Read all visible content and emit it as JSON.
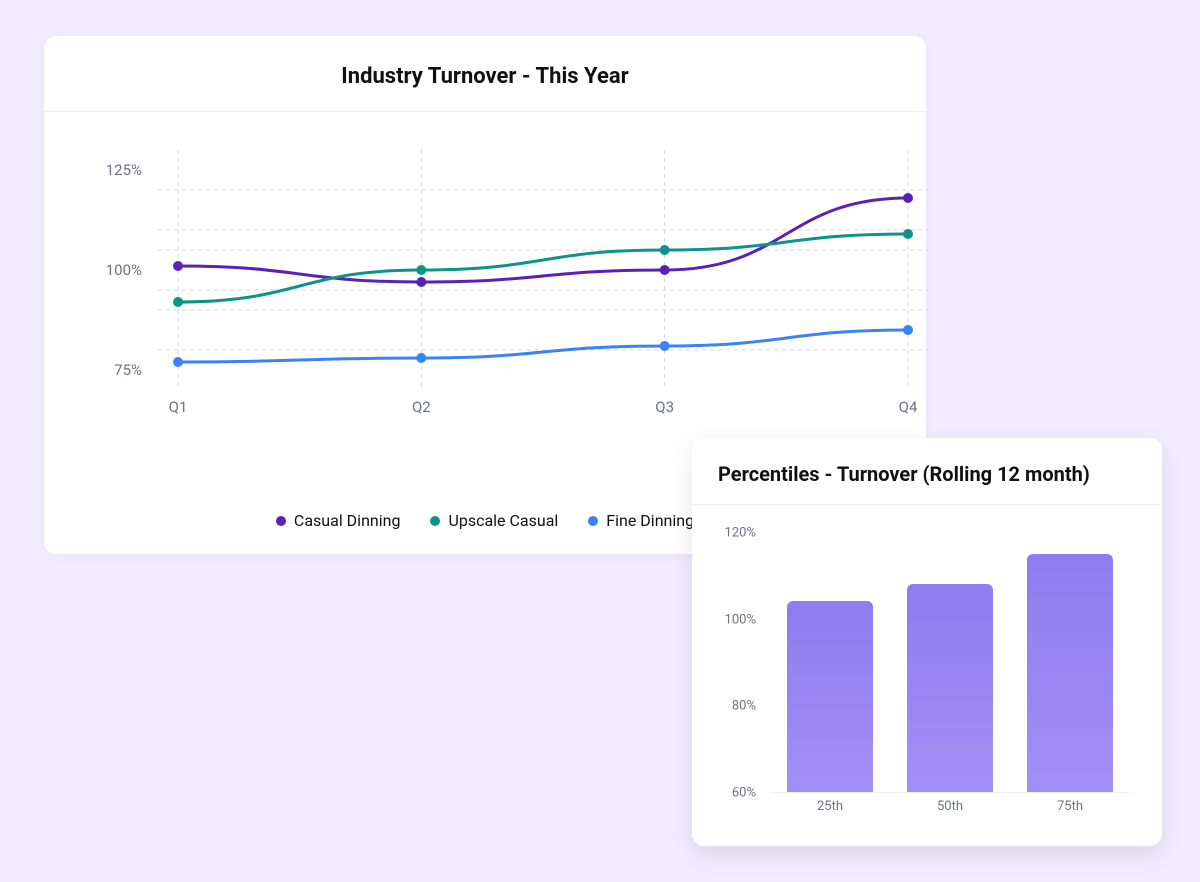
{
  "colors": {
    "casual_dinning": "#5b21b6",
    "upscale_casual": "#0d9488",
    "fine_dinning": "#3b82f6",
    "bar_top": "#8e7cf0",
    "bar_bottom": "#a28ff5",
    "grid": "#d1d5db",
    "axis_label": "#6b7280"
  },
  "chart_data": [
    {
      "type": "line",
      "title": "Industry Turnover - This Year",
      "xlabel": "",
      "ylabel": "",
      "ylim": [
        70,
        130
      ],
      "y_ticks": [
        75,
        100,
        125
      ],
      "y_tick_labels": [
        "75%",
        "100%",
        "125%"
      ],
      "categories": [
        "Q1",
        "Q2",
        "Q3",
        "Q4"
      ],
      "legend": [
        "Casual Dinning",
        "Upscale Casual",
        "Fine Dinning"
      ],
      "series": [
        {
          "name": "Casual Dinning",
          "color_key": "casual_dinning",
          "values": [
            101,
            97,
            100,
            118
          ]
        },
        {
          "name": "Upscale Casual",
          "color_key": "upscale_casual",
          "values": [
            92,
            100,
            105,
            109
          ]
        },
        {
          "name": "Fine Dinning",
          "color_key": "fine_dinning",
          "values": [
            77,
            78,
            81,
            85
          ]
        }
      ]
    },
    {
      "type": "bar",
      "title": "Percentiles - Turnover (Rolling 12 month)",
      "xlabel": "",
      "ylabel": "",
      "ylim": [
        60,
        120
      ],
      "y_ticks": [
        60,
        80,
        100,
        120
      ],
      "y_tick_labels": [
        "60%",
        "80%",
        "100%",
        "120%"
      ],
      "categories": [
        "25th",
        "50th",
        "75th"
      ],
      "values": [
        104,
        108,
        115
      ]
    }
  ]
}
